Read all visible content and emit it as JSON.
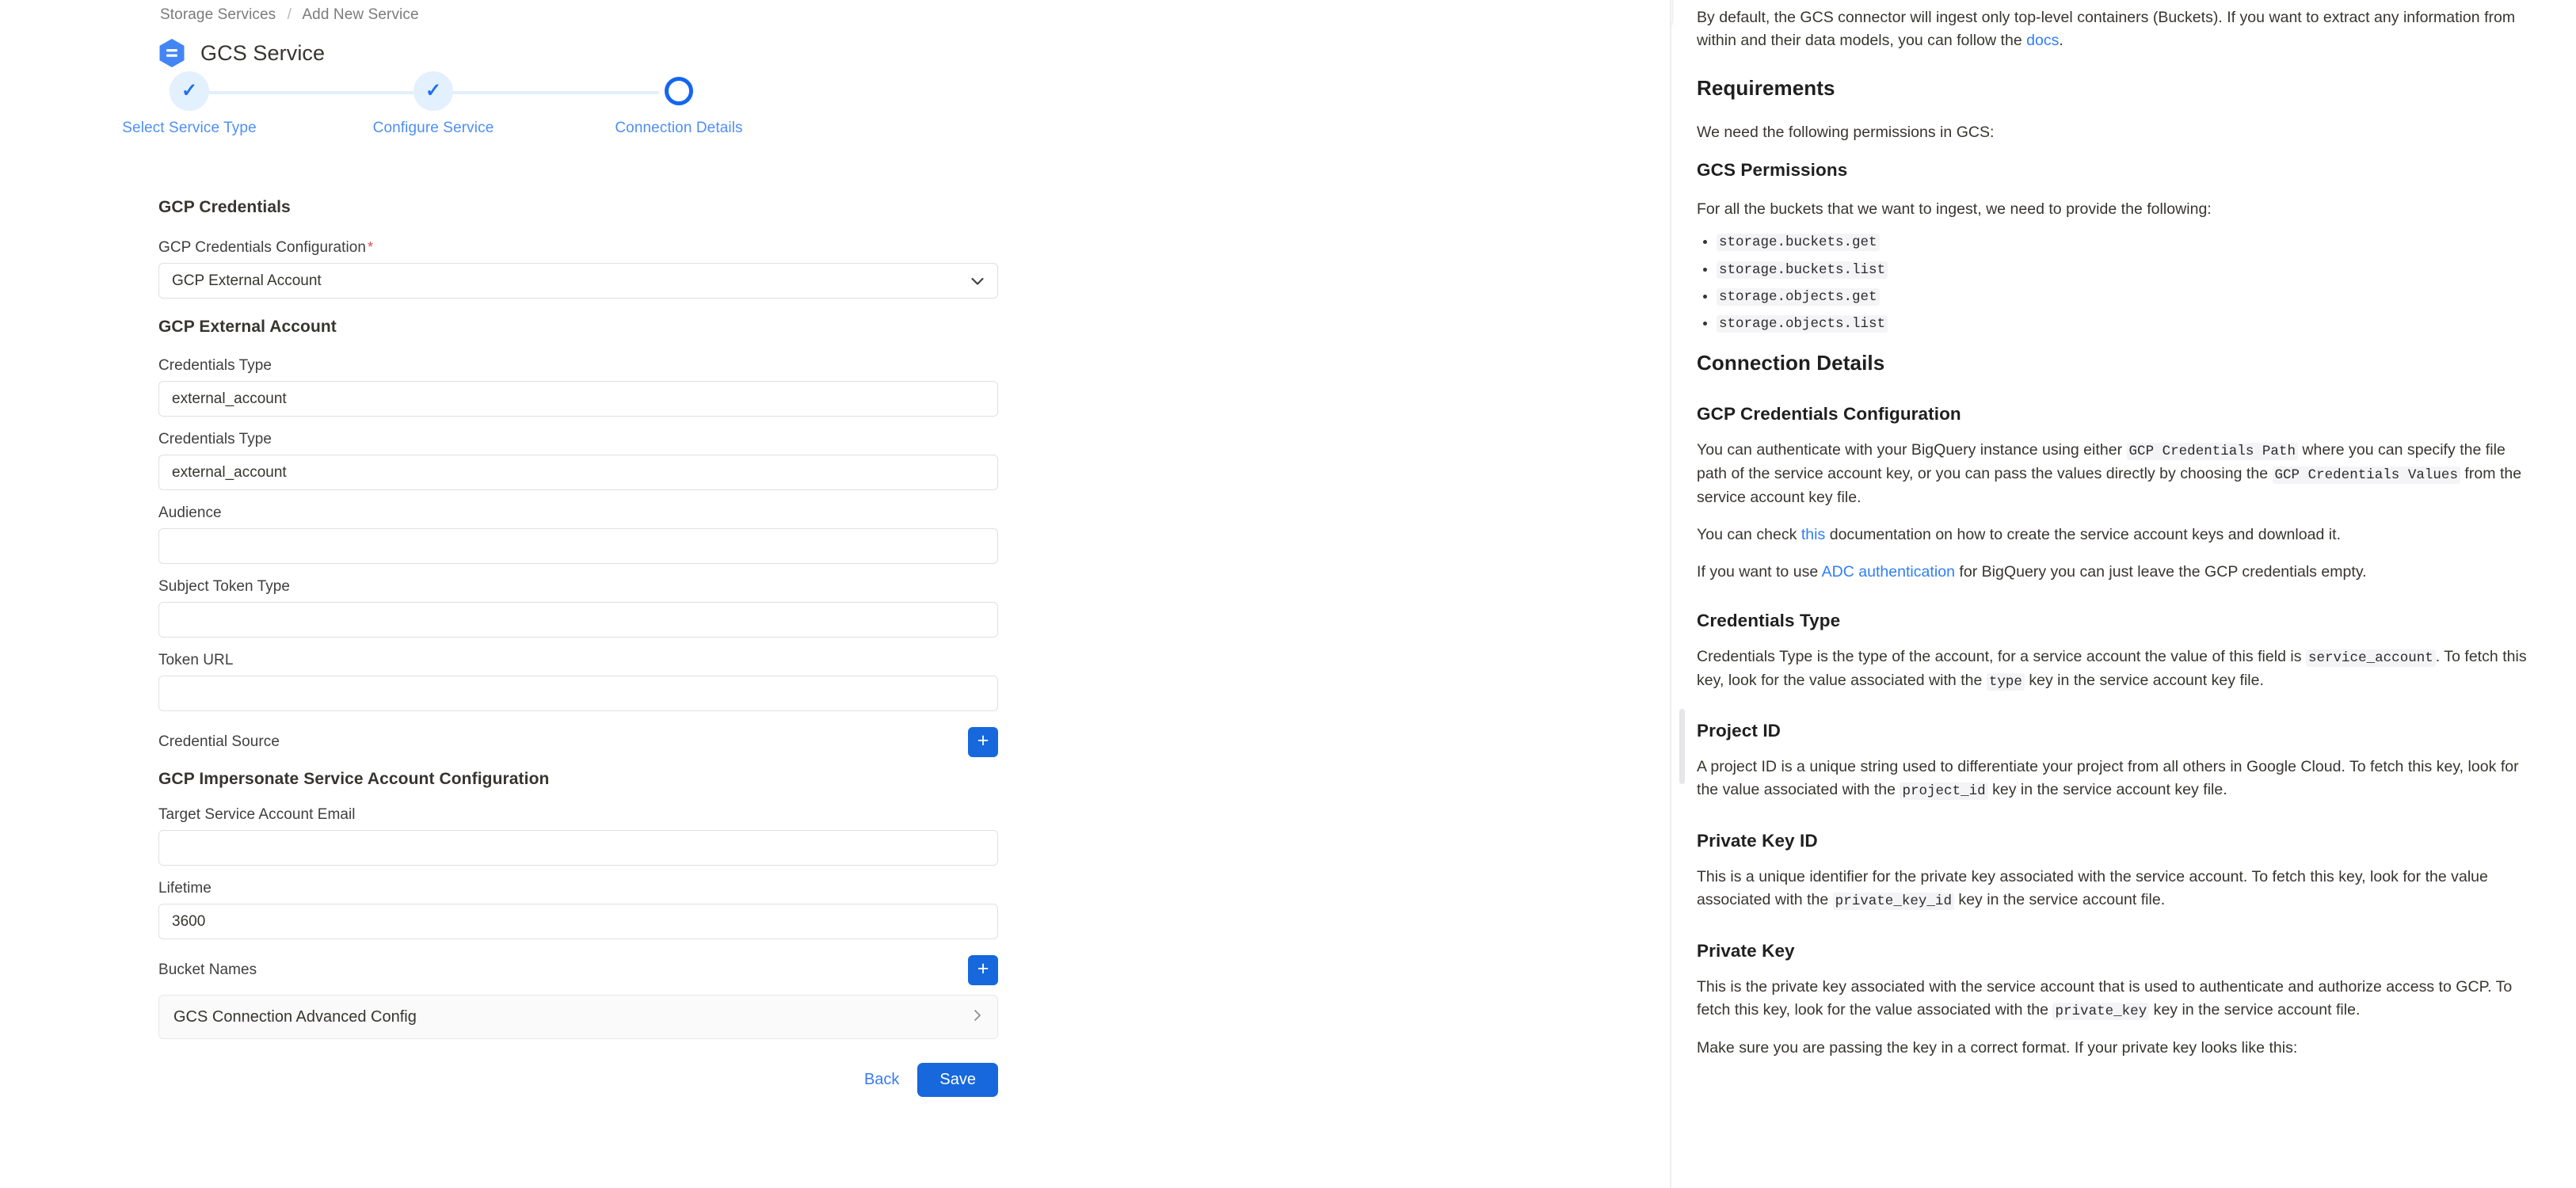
{
  "breadcrumb": {
    "parent": "Storage Services",
    "separator": "/",
    "current": "Add New Service"
  },
  "header": {
    "title": "GCS Service",
    "icon": "gcs-storage-icon",
    "brand_color": "#4285F4"
  },
  "stepper": {
    "steps": [
      {
        "label": "Select Service Type",
        "state": "done"
      },
      {
        "label": "Configure Service",
        "state": "done"
      },
      {
        "label": "Connection Details",
        "state": "active"
      }
    ],
    "active_color": "#1565f0",
    "done_color": "#1d6ef5",
    "label_color": "#4f8ef7"
  },
  "form": {
    "sections": {
      "gcp_credentials": "GCP Credentials",
      "gcp_external_account": "GCP External Account",
      "gcp_impersonate": "GCP Impersonate Service Account Configuration"
    },
    "credentials_configuration": {
      "label": "GCP Credentials Configuration",
      "required_marker": "*",
      "value": "GCP External Account",
      "chevron": "chevron-down-icon"
    },
    "fields": [
      {
        "label": "Credentials Type",
        "value": "external_account",
        "placeholder": ""
      },
      {
        "label": "Credentials Type",
        "value": "external_account",
        "placeholder": ""
      },
      {
        "label": "Audience",
        "value": "",
        "placeholder": ""
      },
      {
        "label": "Subject Token Type",
        "value": "",
        "placeholder": ""
      },
      {
        "label": "Token URL",
        "value": "",
        "placeholder": ""
      }
    ],
    "credential_source": {
      "label": "Credential Source",
      "add_label": "+"
    },
    "impersonate_fields": [
      {
        "label": "Target Service Account Email",
        "value": "",
        "placeholder": ""
      },
      {
        "label": "Lifetime",
        "value": "3600",
        "placeholder": ""
      }
    ],
    "bucket_names": {
      "label": "Bucket Names",
      "add_label": "+"
    },
    "advanced_config": {
      "label": "GCS Connection Advanced Config",
      "chevron": "chevron-right-icon"
    },
    "actions": {
      "back_label": "Back",
      "save_label": "Save",
      "save_color": "#1668dc"
    }
  },
  "right_panel": {
    "code_toggle": "<>",
    "intro": {
      "text_before_link": "By default, the GCS connector will ingest only top-level containers (Buckets). If you want to extract any information from within and their data models, you can follow the ",
      "link": "docs",
      "text_after_link": "."
    },
    "requirements": {
      "heading": "Requirements",
      "lead": "We need the following permissions in GCS:",
      "permissions_heading": "GCS Permissions",
      "permissions_lead": "For all the buckets that we want to ingest, we need to provide the following:",
      "permissions": [
        "storage.buckets.get",
        "storage.buckets.list",
        "storage.objects.get",
        "storage.objects.list"
      ]
    },
    "connection_details": {
      "heading": "Connection Details",
      "gcp_credentials_configuration": {
        "heading": "GCP Credentials Configuration",
        "p1_a": "You can authenticate with your BigQuery instance using either ",
        "p1_code1": "GCP Credentials Path",
        "p1_b": " where you can specify the file path of the service account key, or you can pass the values directly by choosing the ",
        "p1_code2": "GCP Credentials Values",
        "p1_c": " from the service account key file.",
        "p2_a": "You can check ",
        "p2_link": "this",
        "p2_b": " documentation on how to create the service account keys and download it.",
        "p3_a": "If you want to use ",
        "p3_link": "ADC authentication",
        "p3_b": " for BigQuery you can just leave the GCP credentials empty."
      },
      "credentials_type": {
        "heading": "Credentials Type",
        "p_a": "Credentials Type is the type of the account, for a service account the value of this field is ",
        "p_code1": "service_account",
        "p_b": ". To fetch this key, look for the value associated with the ",
        "p_code2": "type",
        "p_c": " key in the service account key file."
      },
      "project_id": {
        "heading": "Project ID",
        "p_a": "A project ID is a unique string used to differentiate your project from all others in Google Cloud. To fetch this key, look for the value associated with the ",
        "p_code": "project_id",
        "p_b": " key in the service account key file."
      },
      "private_key_id": {
        "heading": "Private Key ID",
        "p_a": "This is a unique identifier for the private key associated with the service account. To fetch this key, look for the value associated with the ",
        "p_code": "private_key_id",
        "p_b": " key in the service account file."
      },
      "private_key": {
        "heading": "Private Key",
        "p_a": "This is the private key associated with the service account that is used to authenticate and authorize access to GCP. To fetch this key, look for the value associated with the ",
        "p_code": "private_key",
        "p_b": " key in the service account file.",
        "p2": "Make sure you are passing the key in a correct format. If your private key looks like this:"
      }
    }
  }
}
